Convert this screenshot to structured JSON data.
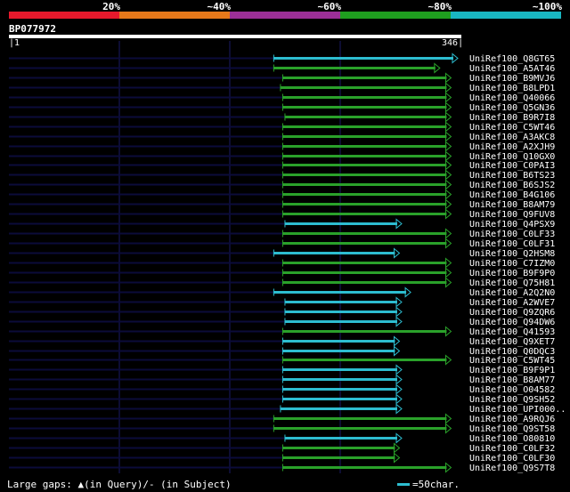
{
  "legend": {
    "segments": [
      {
        "label": "20%",
        "color": "#e8192c"
      },
      {
        "label": "~40%",
        "color": "#e8791a"
      },
      {
        "label": "~60%",
        "color": "#9c2f97"
      },
      {
        "label": "~80%",
        "color": "#1f9e1f"
      },
      {
        "label": "~100%",
        "color": "#19b7c2"
      }
    ]
  },
  "query": {
    "id": "BP077972",
    "start_label": "1",
    "end_label": "346"
  },
  "colors": {
    "cyan": "#2dbdd0",
    "green": "#2aa12a",
    "faint": "#0b0b3a",
    "grid": "#1a1a66"
  },
  "hits": [
    {
      "name": "UniRef100_Q8GT65",
      "color": "cyan",
      "start": 0.59,
      "end": 1.0
    },
    {
      "name": "UniRef100_A5AT46",
      "color": "green",
      "start": 0.59,
      "end": 0.96
    },
    {
      "name": "UniRef100_B9MVJ6",
      "color": "green",
      "start": 0.61,
      "end": 0.985
    },
    {
      "name": "UniRef100_B8LPD1",
      "color": "green",
      "start": 0.605,
      "end": 0.985
    },
    {
      "name": "UniRef100_Q40066",
      "color": "green",
      "start": 0.61,
      "end": 0.985
    },
    {
      "name": "UniRef100_Q5GN36",
      "color": "green",
      "start": 0.61,
      "end": 0.985
    },
    {
      "name": "UniRef100_B9R7I8",
      "color": "green",
      "start": 0.615,
      "end": 0.985
    },
    {
      "name": "UniRef100_C5WT46",
      "color": "green",
      "start": 0.61,
      "end": 0.985
    },
    {
      "name": "UniRef100_A3AKC8",
      "color": "green",
      "start": 0.61,
      "end": 0.985
    },
    {
      "name": "UniRef100_A2XJH9",
      "color": "green",
      "start": 0.61,
      "end": 0.985
    },
    {
      "name": "UniRef100_Q10GX0",
      "color": "green",
      "start": 0.61,
      "end": 0.985
    },
    {
      "name": "UniRef100_C0PAI3",
      "color": "green",
      "start": 0.61,
      "end": 0.985
    },
    {
      "name": "UniRef100_B6TS23",
      "color": "green",
      "start": 0.61,
      "end": 0.985
    },
    {
      "name": "UniRef100_B6SJS2",
      "color": "green",
      "start": 0.61,
      "end": 0.985
    },
    {
      "name": "UniRef100_B4G106",
      "color": "green",
      "start": 0.61,
      "end": 0.985
    },
    {
      "name": "UniRef100_B8AM79",
      "color": "green",
      "start": 0.61,
      "end": 0.985
    },
    {
      "name": "UniRef100_Q9FUV8",
      "color": "green",
      "start": 0.61,
      "end": 0.985
    },
    {
      "name": "UniRef100_Q4PSX9",
      "color": "cyan",
      "start": 0.615,
      "end": 0.875
    },
    {
      "name": "UniRef100_C0LF33",
      "color": "green",
      "start": 0.61,
      "end": 0.985
    },
    {
      "name": "UniRef100_C0LF31",
      "color": "green",
      "start": 0.61,
      "end": 0.985
    },
    {
      "name": "UniRef100_Q2HSM8",
      "color": "cyan",
      "start": 0.59,
      "end": 0.87
    },
    {
      "name": "UniRef100_C7IZM0",
      "color": "green",
      "start": 0.61,
      "end": 0.985
    },
    {
      "name": "UniRef100_B9F9P0",
      "color": "green",
      "start": 0.61,
      "end": 0.985
    },
    {
      "name": "UniRef100_Q75H81",
      "color": "green",
      "start": 0.61,
      "end": 0.985
    },
    {
      "name": "UniRef100_A2Q2N0",
      "color": "cyan",
      "start": 0.59,
      "end": 0.895
    },
    {
      "name": "UniRef100_A2WVE7",
      "color": "cyan",
      "start": 0.615,
      "end": 0.875
    },
    {
      "name": "UniRef100_Q9ZQR6",
      "color": "cyan",
      "start": 0.615,
      "end": 0.875
    },
    {
      "name": "UniRef100_Q94DW6",
      "color": "cyan",
      "start": 0.615,
      "end": 0.875
    },
    {
      "name": "UniRef100_Q41593",
      "color": "green",
      "start": 0.61,
      "end": 0.985
    },
    {
      "name": "UniRef100_Q9XET7",
      "color": "cyan",
      "start": 0.61,
      "end": 0.87
    },
    {
      "name": "UniRef100_Q0DQC3",
      "color": "cyan",
      "start": 0.61,
      "end": 0.87
    },
    {
      "name": "UniRef100_C5WT45",
      "color": "green",
      "start": 0.61,
      "end": 0.985
    },
    {
      "name": "UniRef100_B9F9P1",
      "color": "cyan",
      "start": 0.61,
      "end": 0.875
    },
    {
      "name": "UniRef100_B8AM77",
      "color": "cyan",
      "start": 0.61,
      "end": 0.875
    },
    {
      "name": "UniRef100_O04582",
      "color": "cyan",
      "start": 0.61,
      "end": 0.875
    },
    {
      "name": "UniRef100_Q9SH52",
      "color": "cyan",
      "start": 0.61,
      "end": 0.875
    },
    {
      "name": "UniRef100_UPI000..",
      "color": "cyan",
      "start": 0.605,
      "end": 0.875
    },
    {
      "name": "UniRef100_A9RQJ6",
      "color": "green",
      "start": 0.59,
      "end": 0.985
    },
    {
      "name": "UniRef100_Q9ST58",
      "color": "green",
      "start": 0.59,
      "end": 0.985
    },
    {
      "name": "UniRef100_O80810",
      "color": "cyan",
      "start": 0.615,
      "end": 0.875
    },
    {
      "name": "UniRef100_C0LF32",
      "color": "green",
      "start": 0.61,
      "end": 0.87
    },
    {
      "name": "UniRef100_C0LF30",
      "color": "green",
      "start": 0.61,
      "end": 0.87
    },
    {
      "name": "UniRef100_Q9S7T8",
      "color": "green",
      "start": 0.61,
      "end": 0.985
    }
  ],
  "footer": {
    "gaps_text": "Large gaps: ▲(in Query)/- (in Subject)",
    "scale_text": "=50char."
  }
}
